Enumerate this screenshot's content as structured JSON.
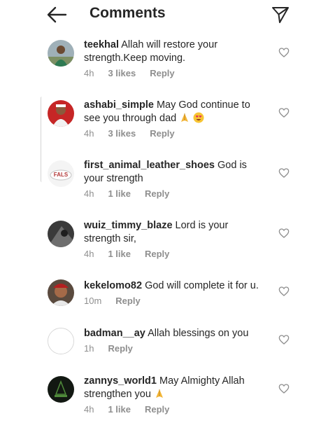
{
  "header": {
    "title": "Comments"
  },
  "colors": {
    "text": "#262626",
    "muted": "#8e8e8e"
  },
  "comments": [
    {
      "user": "teekhal",
      "text": "Allah will restore your strength.Keep moving.",
      "time": "4h",
      "likes": "3 likes",
      "reply": "Reply",
      "emojis": []
    },
    {
      "user": "ashabi_simple",
      "text": "May God continue to see you through dad",
      "time": "4h",
      "likes": "3 likes",
      "reply": "Reply",
      "emojis": [
        "folded-hands-emoji",
        "heart-eyes-emoji"
      ]
    },
    {
      "user": "first_animal_leather_shoes",
      "text": "God is your strength",
      "time": "4h",
      "likes": "1 like",
      "reply": "Reply",
      "emojis": []
    },
    {
      "user": "wuiz_timmy_blaze",
      "text": "Lord is your strength sir,",
      "time": "4h",
      "likes": "1 like",
      "reply": "Reply",
      "emojis": []
    },
    {
      "user": "kekelomo82",
      "text": "God will complete it for u.",
      "time": "10m",
      "likes": "",
      "reply": "Reply",
      "emojis": []
    },
    {
      "user": "badman__ay",
      "text": "Allah blessings on you",
      "time": "1h",
      "likes": "",
      "reply": "Reply",
      "emojis": []
    },
    {
      "user": "zannys_world1",
      "text": "May Almighty Allah strengthen you",
      "time": "4h",
      "likes": "1 like",
      "reply": "Reply",
      "emojis": [
        "folded-hands-emoji"
      ]
    }
  ],
  "icons": {
    "back": "arrow-left-icon",
    "send": "direct-send-icon",
    "like": "heart-outline-icon"
  }
}
